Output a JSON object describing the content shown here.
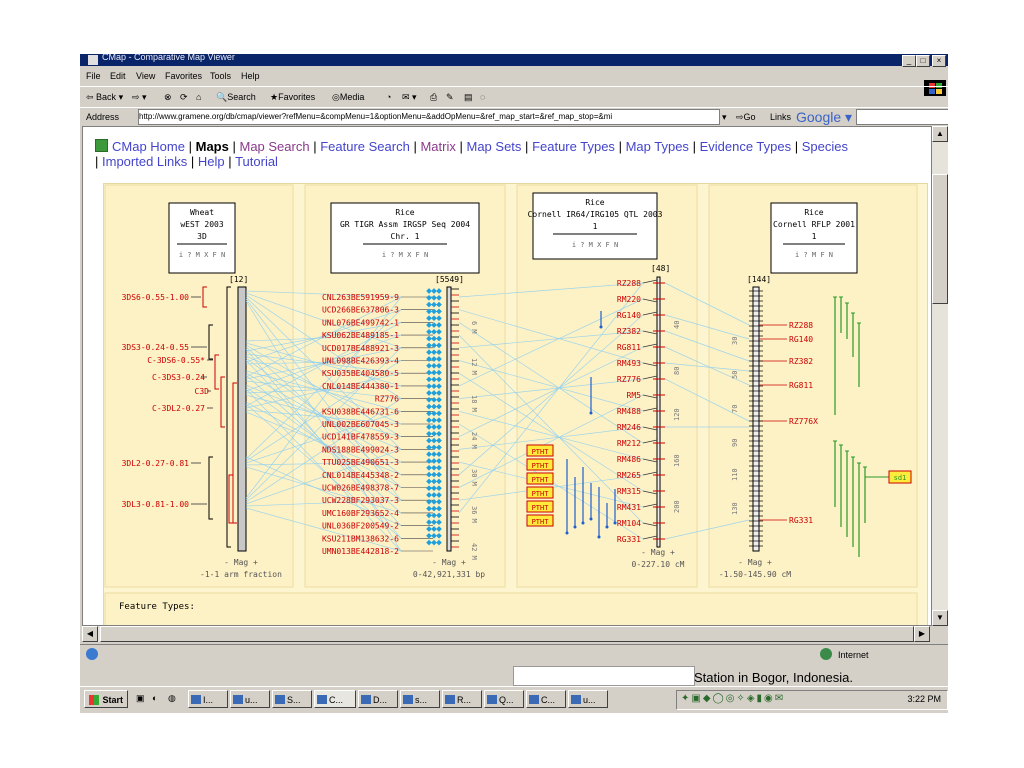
{
  "window": {
    "title": "CMap - Comparative Map Viewer"
  },
  "menu": [
    "File",
    "Edit",
    "View",
    "Favorites",
    "Tools",
    "Help"
  ],
  "toolbar": {
    "back": "Back",
    "forward": "",
    "search": "Search",
    "favorites": "Favorites",
    "media": "Media"
  },
  "address": {
    "label": "Address",
    "url": "http://www.gramene.org/db/cmap/viewer?refMenu=&compMenu=1&optionMenu=&addOpMenu=&ref_map_start=&ref_map_stop=&mi",
    "go": "Go",
    "links": "Links",
    "google": "Google"
  },
  "nav": {
    "home": "CMap Home",
    "maps": "Maps",
    "map_search": "Map Search",
    "feature_search": "Feature Search",
    "matrix": "Matrix",
    "map_sets": "Map Sets",
    "feature_types": "Feature Types",
    "map_types": "Map Types",
    "evidence_types": "Evidence Types",
    "species": "Species",
    "imported_links": "Imported Links",
    "help": "Help",
    "tutorial": "Tutorial"
  },
  "maps": [
    {
      "title": [
        "Wheat",
        "wEST 2003",
        "3D"
      ],
      "buttons": "i ? M X F N",
      "count": "[12]",
      "footer": [
        "- Mag +",
        "-1-1 arm fraction"
      ]
    },
    {
      "title": [
        "Rice",
        "GR TIGR Assm IRGSP Seq 2004",
        "Chr. 1"
      ],
      "buttons": "i ? M X F N",
      "count": "[5549]",
      "footer": [
        "- Mag +",
        "0-42,921,331 bp"
      ]
    },
    {
      "title": [
        "Rice",
        "Cornell IR64/IRG105 QTL 2003",
        "1"
      ],
      "buttons": "i ? M X F N",
      "count": "[48]",
      "footer": [
        "- Mag +",
        "0-227.10 cM"
      ]
    },
    {
      "title": [
        "Rice",
        "Cornell RFLP 2001",
        "1"
      ],
      "buttons": "i ? M F N",
      "count": "[144]",
      "footer": [
        "- Mag +",
        "-1.50-145.90 cM"
      ]
    }
  ],
  "wheat_labels": [
    "3DS6-0.55-1.00",
    "3DS3-0.24-0.55",
    "C-3DS6-0.55*",
    "C-3DS3-0.24",
    "C3D",
    "C-3DL2-0.27",
    "3DL2-0.27-0.81",
    "3DL3-0.81-1.00"
  ],
  "rice_seq_labels": [
    "CNL263BE591959-9",
    "UCD266BE637806-3",
    "UNL076BE499742-1",
    "KSU062BE489185-1",
    "UCD017BE488921-3",
    "UNL098BE426393-4",
    "KSU035BE404580-5",
    "CNL014BE444380-1",
    "RZ776",
    "KSU038BE446731-6",
    "UNL002BE607045-3",
    "UCD141BF478559-3",
    "NDS188BE499024-3",
    "TTU025BE490651-3",
    "CNL014BE445348-2",
    "UCW026BE498378-7",
    "UCW228BF293037-3",
    "UMC160BF293652-4",
    "UNL036BF200549-2",
    "KSU211BM138632-6",
    "UMN013BE442818-2"
  ],
  "rice_seq_ticks": [
    "6 M",
    "12 M",
    "18 M",
    "24 M",
    "30 M",
    "36 M",
    "42 M"
  ],
  "qtl_labels": [
    "RZ288",
    "RM220",
    "RG140",
    "RZ382",
    "RG811",
    "RM493",
    "RZ776",
    "RM5",
    "RM488",
    "RM246",
    "RM212",
    "RM486",
    "RM265",
    "RM315",
    "RM431",
    "RM104",
    "RG331"
  ],
  "qtl_ticks": [
    "40",
    "80",
    "120",
    "160",
    "200"
  ],
  "qtl_boxes": [
    "PTHT",
    "PTHT",
    "PTHT",
    "PTHT",
    "PTHT",
    "PTHT"
  ],
  "rflp_labels": [
    "RZ288",
    "RG140",
    "RZ382",
    "RG811",
    "RZ776X",
    "RG331"
  ],
  "rflp_ticks": [
    "30",
    "50",
    "70",
    "90",
    "110",
    "130"
  ],
  "rflp_box": "sd1",
  "feature_types_label": "Feature Types:",
  "status": {
    "zone": "Internet"
  },
  "behind_text": "Station in Bogor, Indonesia.",
  "taskbar": {
    "start": "Start",
    "buttons": [
      "I...",
      "u...",
      "S...",
      "C...",
      "D...",
      "s...",
      "R...",
      "Q...",
      "C...",
      "u..."
    ],
    "clock": "3:22 PM"
  }
}
